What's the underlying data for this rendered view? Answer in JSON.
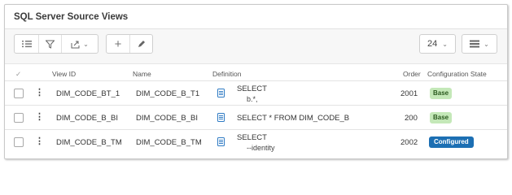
{
  "panel": {
    "title": "SQL Server Source Views"
  },
  "toolbar": {
    "list_icon": "list-icon",
    "filter_icon": "filter-icon",
    "export_icon": "export-icon",
    "add_icon": "plus-icon",
    "edit_icon": "pencil-icon",
    "page_size": "24",
    "view_menu_icon": "menu-icon"
  },
  "table": {
    "headers": {
      "select": "✓",
      "view_id": "View ID",
      "name": "Name",
      "definition": "Definition",
      "order": "Order",
      "config_state": "Configuration State"
    },
    "rows": [
      {
        "view_id": "DIM_CODE_BT_1",
        "name": "DIM_CODE_B_T1",
        "definition_line1": "SELECT",
        "definition_line2": "b.*,",
        "order": "2001",
        "state": "Base"
      },
      {
        "view_id": "DIM_CODE_B_BI",
        "name": "DIM_CODE_B_BI",
        "definition_line1": "SELECT * FROM DIM_CODE_B",
        "definition_line2": "",
        "order": "200",
        "state": "Base"
      },
      {
        "view_id": "DIM_CODE_B_TM",
        "name": "DIM_CODE_B_TM",
        "definition_line1": "SELECT",
        "definition_line2": "--identity",
        "order": "2002",
        "state": "Configured"
      }
    ]
  },
  "colors": {
    "base_badge": "#c4e8b8",
    "configured_badge": "#1c6fb3",
    "doc_icon": "#2f7bc4"
  }
}
